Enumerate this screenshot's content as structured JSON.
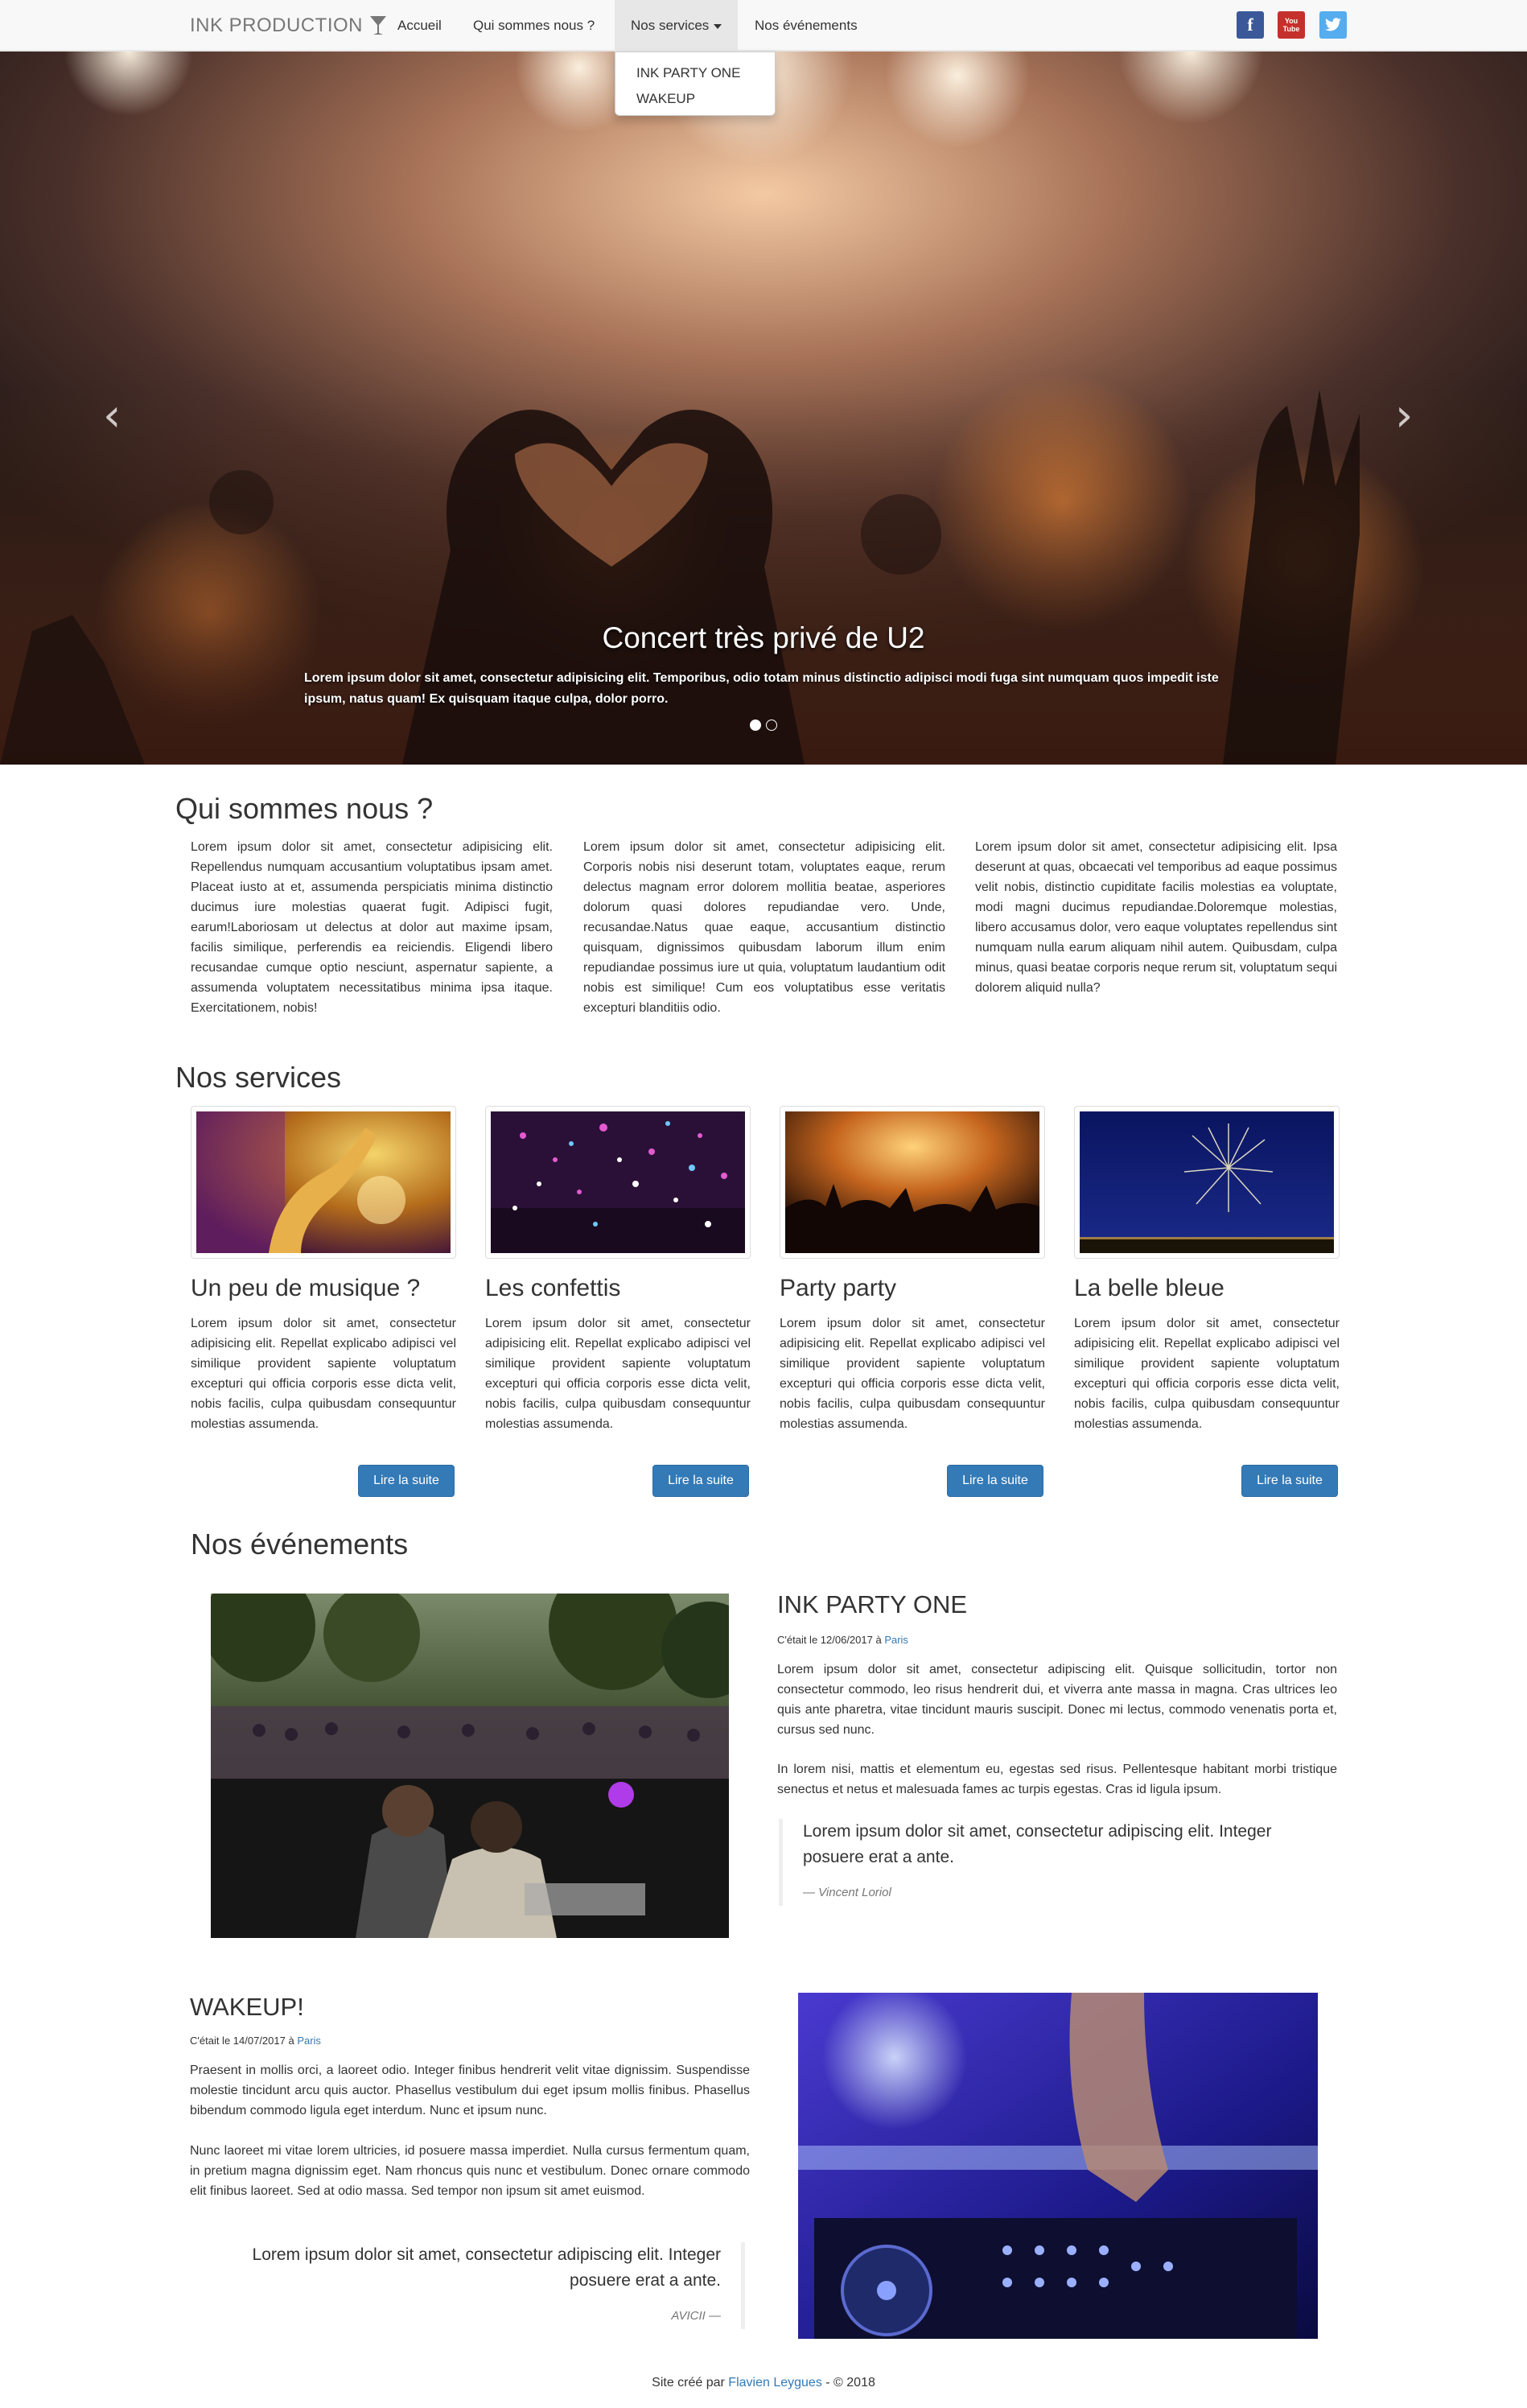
{
  "nav": {
    "brand": "INK PRODUCTION",
    "items": [
      {
        "label": "Accueil"
      },
      {
        "label": "Qui sommes nous ?"
      },
      {
        "label": "Nos services"
      },
      {
        "label": "Nos événements"
      }
    ],
    "dropdown": [
      "INK PARTY ONE",
      "WAKEUP"
    ],
    "social": [
      "facebook-icon",
      "youtube-icon",
      "twitter-icon"
    ],
    "facebook_glyph": "f",
    "youtube_glyph": "You Tube",
    "twitter_glyph": "t"
  },
  "carousel": {
    "title": "Concert très privé de U2",
    "text": "Lorem ipsum dolor sit amet, consectetur adipisicing elit. Temporibus, odio totam minus distinctio adipisci modi fuga sint numquam quos impedit iste ipsum, natus quam! Ex quisquam itaque culpa, dolor porro.",
    "prev": "‹",
    "next": "›",
    "slides": 2,
    "active_slide": 1
  },
  "about": {
    "title": "Qui sommes nous ?",
    "columns": [
      "Lorem ipsum dolor sit amet, consectetur adipisicing elit. Repellendus numquam accusantium voluptatibus ipsam amet. Placeat iusto at et, assumenda perspiciatis minima distinctio ducimus iure molestias quaerat fugit. Adipisci fugit, earum!Laboriosam ut delectus at dolor aut maxime ipsam, facilis similique, perferendis ea reiciendis. Eligendi libero recusandae cumque optio nesciunt, aspernatur sapiente, a assumenda voluptatem necessitatibus minima ipsa itaque. Exercitationem, nobis!",
      "Lorem ipsum dolor sit amet, consectetur adipisicing elit. Corporis nobis nisi deserunt totam, voluptates eaque, rerum delectus magnam error dolorem mollitia beatae, asperiores dolorum quasi dolores repudiandae vero. Unde, recusandae.Natus quae eaque, accusantium distinctio quisquam, dignissimos quibusdam laborum illum enim repudiandae possimus iure ut quia, voluptatum laudantium odit nobis est similique! Cum eos voluptatibus esse veritatis excepturi blanditiis odio.",
      "Lorem ipsum dolor sit amet, consectetur adipisicing elit. Ipsa deserunt at quas, obcaecati vel temporibus ad eaque possimus velit nobis, distinctio cupiditate facilis molestias ea voluptate, modi magni ducimus repudiandae.Doloremque molestias, libero accusamus dolor, vero eaque voluptates repellendus sint numquam nulla earum aliquam nihil autem. Quibusdam, culpa minus, quasi beatae corporis neque rerum sit, voluptatum sequi dolorem aliquid nulla?"
    ]
  },
  "services": {
    "title": "Nos services",
    "items": [
      {
        "title": "Un peu de musique ?",
        "text": "Lorem ipsum dolor sit amet, consectetur adipisicing elit. Repellat explicabo adipisci vel similique provident sapiente voluptatum excepturi qui officia corporis esse dicta velit, nobis facilis, culpa quibusdam consequuntur molestias assumenda.",
        "button": "Lire la suite"
      },
      {
        "title": "Les confettis",
        "text": "Lorem ipsum dolor sit amet, consectetur adipisicing elit. Repellat explicabo adipisci vel similique provident sapiente voluptatum excepturi qui officia corporis esse dicta velit, nobis facilis, culpa quibusdam consequuntur molestias assumenda.",
        "button": "Lire la suite"
      },
      {
        "title": "Party party",
        "text": "Lorem ipsum dolor sit amet, consectetur adipisicing elit. Repellat explicabo adipisci vel similique provident sapiente voluptatum excepturi qui officia corporis esse dicta velit, nobis facilis, culpa quibusdam consequuntur molestias assumenda.",
        "button": "Lire la suite"
      },
      {
        "title": "La belle bleue",
        "text": "Lorem ipsum dolor sit amet, consectetur adipisicing elit. Repellat explicabo adipisci vel similique provident sapiente voluptatum excepturi qui officia corporis esse dicta velit, nobis facilis, culpa quibusdam consequuntur molestias assumenda.",
        "button": "Lire la suite"
      }
    ]
  },
  "events": {
    "title": "Nos événements",
    "items": [
      {
        "title": "INK PARTY ONE",
        "date_prefix": "C'était le 12/06/2017 à ",
        "place": "Paris",
        "paragraphs": [
          "Lorem ipsum dolor sit amet, consectetur adipiscing elit. Quisque sollicitudin, tortor non consectetur commodo, leo risus hendrerit dui, et viverra ante massa in magna. Cras ultrices leo quis ante pharetra, vitae tincidunt mauris suscipit. Donec mi lectus, commodo venenatis porta et, cursus sed nunc.",
          "In lorem nisi, mattis et elementum eu, egestas sed risus. Pellentesque habitant morbi tristique senectus et netus et malesuada fames ac turpis egestas. Cras id ligula ipsum."
        ],
        "quote": "Lorem ipsum dolor sit amet, consectetur adipiscing elit. Integer posuere erat a ante.",
        "quote_author": "— Vincent Loriol"
      },
      {
        "title": "WAKEUP!",
        "date_prefix": "C'était le 14/07/2017 à ",
        "place": "Paris",
        "paragraphs": [
          "Praesent in mollis orci, a laoreet odio. Integer finibus hendrerit velit vitae dignissim. Suspendisse molestie tincidunt arcu quis auctor. Phasellus vestibulum dui eget ipsum mollis finibus. Phasellus bibendum commodo ligula eget interdum. Nunc et ipsum nunc.",
          "Nunc laoreet mi vitae lorem ultricies, id posuere massa imperdiet. Nulla cursus fermentum quam, in pretium magna dignissim eget. Nam rhoncus quis nunc et vestibulum. Donec ornare commodo elit finibus laoreet. Sed at odio massa. Sed tempor non ipsum sit amet euismod."
        ],
        "quote": "Lorem ipsum dolor sit amet, consectetur adipiscing elit. Integer posuere erat a ante.",
        "quote_author": "AVICII —"
      }
    ]
  },
  "footer": {
    "prefix": "Site créé par ",
    "author": "Flavien Leygues",
    "suffix": " - © 2018"
  }
}
